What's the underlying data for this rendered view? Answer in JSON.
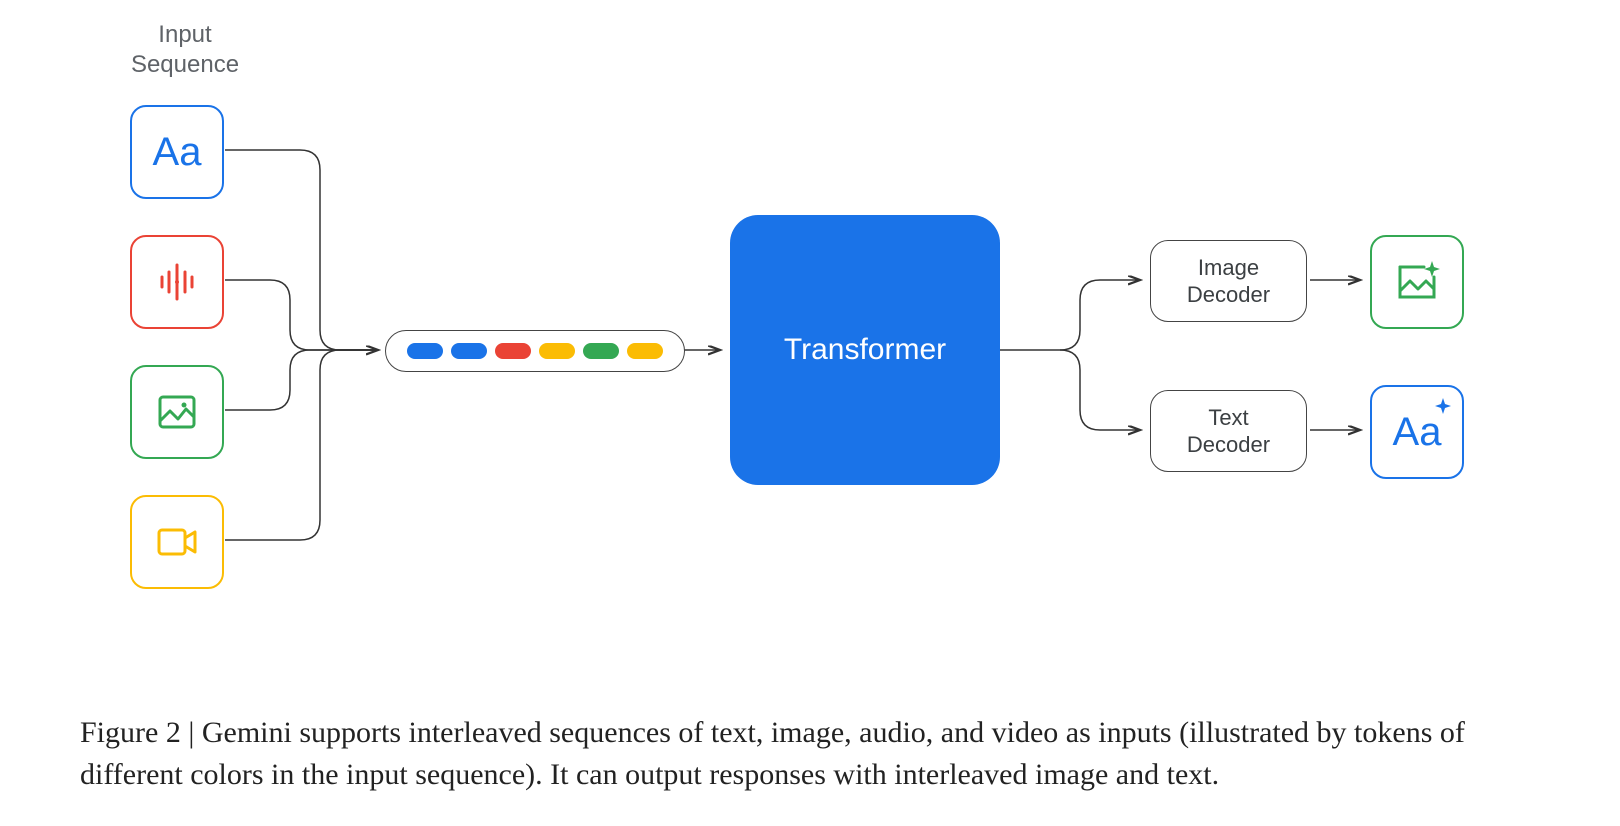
{
  "header": {
    "input_sequence_label": "Input\nSequence"
  },
  "inputs": {
    "text": {
      "name": "text-icon",
      "glyph": "Aa",
      "color": "#1a73e8"
    },
    "audio": {
      "name": "audio-icon",
      "color": "#ea4335"
    },
    "image": {
      "name": "image-icon",
      "color": "#34a853"
    },
    "video": {
      "name": "video-icon",
      "color": "#fbbc04"
    }
  },
  "tokens": {
    "colors": [
      "#1a73e8",
      "#1a73e8",
      "#ea4335",
      "#fbbc04",
      "#34a853",
      "#fbbc04"
    ]
  },
  "transformer": {
    "label": "Transformer"
  },
  "decoders": {
    "image": {
      "label": "Image\nDecoder"
    },
    "text": {
      "label": "Text\nDecoder"
    }
  },
  "outputs": {
    "image": {
      "name": "generated-image-icon",
      "color": "#34a853"
    },
    "text": {
      "name": "generated-text-icon",
      "glyph": "Aa",
      "color": "#1a73e8"
    }
  },
  "caption": {
    "prefix": "Figure 2 | ",
    "body": "Gemini supports interleaved sequences of text, image, audio, and video as inputs (illustrated by tokens of different colors in the input sequence). It can output responses with interleaved image and text."
  }
}
